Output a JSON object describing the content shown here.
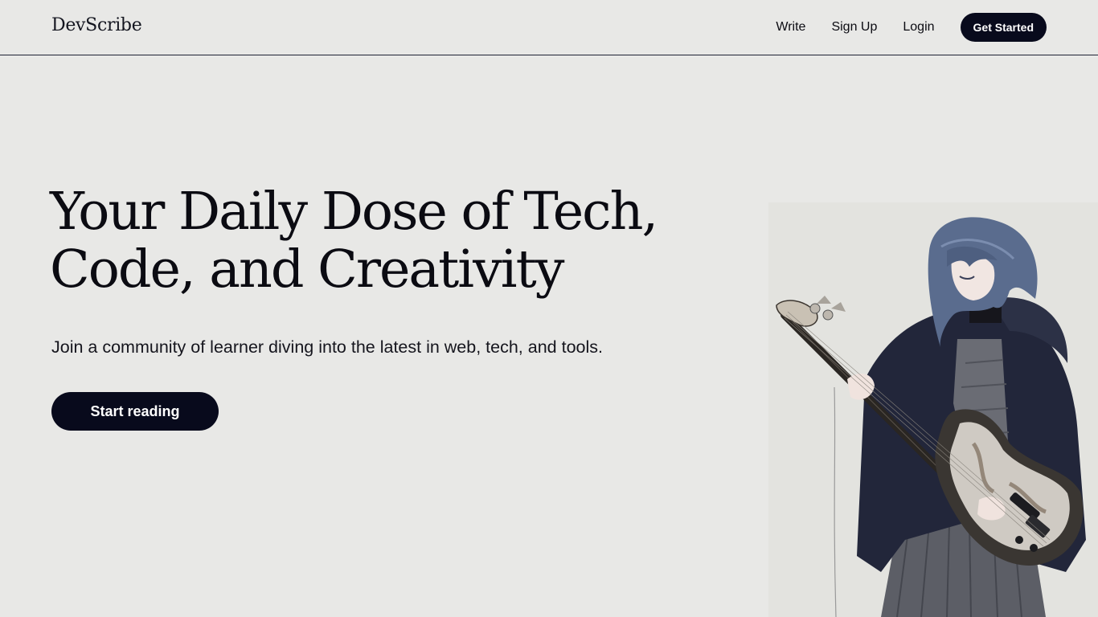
{
  "brand": {
    "logo_text": "DevScribe"
  },
  "nav": {
    "links": [
      {
        "label": "Write"
      },
      {
        "label": "Sign Up"
      },
      {
        "label": "Login"
      }
    ],
    "cta_label": "Get Started"
  },
  "hero": {
    "title_line1": "Your Daily Dose of Tech,",
    "title_line2": "Code, and Creativity",
    "subtitle": "Join a community of learner diving into the latest in web, tech, and tools.",
    "button_label": "Start reading",
    "illustration": "anime-girl-playing-bass-guitar"
  },
  "colors": {
    "background": "#e8e8e6",
    "primary_dark": "#080a1c",
    "text": "#0b0b12",
    "divider": "#1e2233"
  }
}
